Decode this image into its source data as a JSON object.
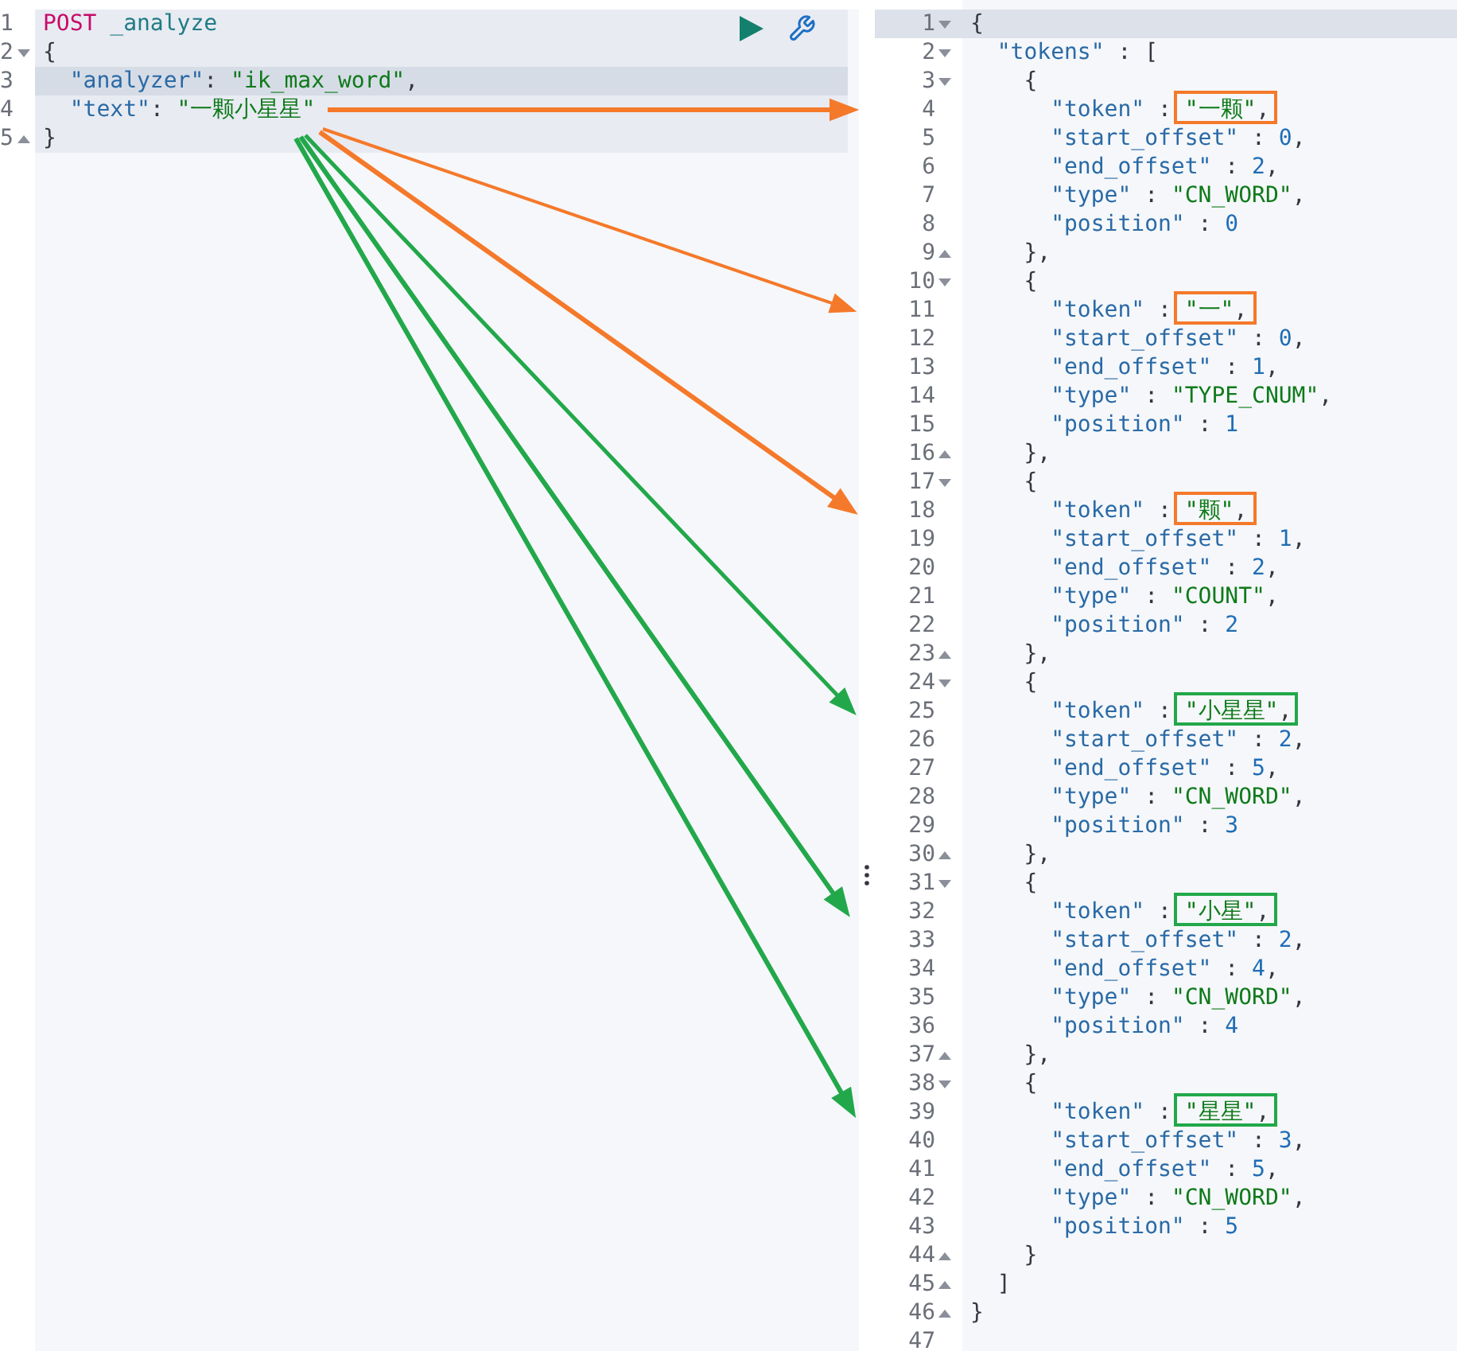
{
  "request": {
    "lines": [
      {
        "n": "1",
        "kind": "plain",
        "active": false,
        "segments": [
          {
            "kind": "method",
            "text": "POST"
          },
          {
            "kind": "path",
            "text": " _analyze"
          }
        ]
      },
      {
        "n": "2",
        "kind": "start",
        "active": false,
        "segments": [
          {
            "kind": "punct",
            "text": "{"
          }
        ]
      },
      {
        "n": "3",
        "kind": "plain",
        "active": true,
        "segments": [
          {
            "kind": "key",
            "text": "  \"analyzer\""
          },
          {
            "kind": "punct",
            "text": ": "
          },
          {
            "kind": "string",
            "text": "\"ik_max_word\""
          },
          {
            "kind": "punct",
            "text": ","
          }
        ]
      },
      {
        "n": "4",
        "kind": "plain",
        "active": false,
        "segments": [
          {
            "kind": "key",
            "text": "  \"text\""
          },
          {
            "kind": "punct",
            "text": ": "
          },
          {
            "kind": "string",
            "text": "\"一颗小星星\""
          }
        ]
      },
      {
        "n": "5",
        "kind": "end",
        "active": false,
        "segments": [
          {
            "kind": "punct",
            "text": "}"
          }
        ]
      }
    ]
  },
  "response": {
    "lines": [
      {
        "n": "1",
        "kind": "start",
        "active": true,
        "segments": [
          {
            "kind": "punct",
            "text": "{"
          }
        ]
      },
      {
        "n": "2",
        "kind": "start",
        "active": false,
        "segments": [
          {
            "kind": "key",
            "text": "  \"tokens\""
          },
          {
            "kind": "punct",
            "text": " : ["
          }
        ]
      },
      {
        "n": "3",
        "kind": "start",
        "active": false,
        "segments": [
          {
            "kind": "punct",
            "text": "    {"
          }
        ]
      },
      {
        "n": "4",
        "kind": "plain",
        "active": false,
        "segments": [
          {
            "kind": "key",
            "text": "      \"token\""
          },
          {
            "kind": "punct",
            "text": " : "
          },
          {
            "kind": "string",
            "text": "\"一颗\""
          },
          {
            "kind": "punct",
            "text": ","
          }
        ]
      },
      {
        "n": "5",
        "kind": "plain",
        "active": false,
        "segments": [
          {
            "kind": "key",
            "text": "      \"start_offset\""
          },
          {
            "kind": "punct",
            "text": " : "
          },
          {
            "kind": "number",
            "text": "0"
          },
          {
            "kind": "punct",
            "text": ","
          }
        ]
      },
      {
        "n": "6",
        "kind": "plain",
        "active": false,
        "segments": [
          {
            "kind": "key",
            "text": "      \"end_offset\""
          },
          {
            "kind": "punct",
            "text": " : "
          },
          {
            "kind": "number",
            "text": "2"
          },
          {
            "kind": "punct",
            "text": ","
          }
        ]
      },
      {
        "n": "7",
        "kind": "plain",
        "active": false,
        "segments": [
          {
            "kind": "key",
            "text": "      \"type\""
          },
          {
            "kind": "punct",
            "text": " : "
          },
          {
            "kind": "string",
            "text": "\"CN_WORD\""
          },
          {
            "kind": "punct",
            "text": ","
          }
        ]
      },
      {
        "n": "8",
        "kind": "plain",
        "active": false,
        "segments": [
          {
            "kind": "key",
            "text": "      \"position\""
          },
          {
            "kind": "punct",
            "text": " : "
          },
          {
            "kind": "number",
            "text": "0"
          }
        ]
      },
      {
        "n": "9",
        "kind": "end",
        "active": false,
        "segments": [
          {
            "kind": "punct",
            "text": "    },"
          }
        ]
      },
      {
        "n": "10",
        "kind": "start",
        "active": false,
        "segments": [
          {
            "kind": "punct",
            "text": "    {"
          }
        ]
      },
      {
        "n": "11",
        "kind": "plain",
        "active": false,
        "segments": [
          {
            "kind": "key",
            "text": "      \"token\""
          },
          {
            "kind": "punct",
            "text": " : "
          },
          {
            "kind": "string",
            "text": "\"一\""
          },
          {
            "kind": "punct",
            "text": ","
          }
        ]
      },
      {
        "n": "12",
        "kind": "plain",
        "active": false,
        "segments": [
          {
            "kind": "key",
            "text": "      \"start_offset\""
          },
          {
            "kind": "punct",
            "text": " : "
          },
          {
            "kind": "number",
            "text": "0"
          },
          {
            "kind": "punct",
            "text": ","
          }
        ]
      },
      {
        "n": "13",
        "kind": "plain",
        "active": false,
        "segments": [
          {
            "kind": "key",
            "text": "      \"end_offset\""
          },
          {
            "kind": "punct",
            "text": " : "
          },
          {
            "kind": "number",
            "text": "1"
          },
          {
            "kind": "punct",
            "text": ","
          }
        ]
      },
      {
        "n": "14",
        "kind": "plain",
        "active": false,
        "segments": [
          {
            "kind": "key",
            "text": "      \"type\""
          },
          {
            "kind": "punct",
            "text": " : "
          },
          {
            "kind": "string",
            "text": "\"TYPE_CNUM\""
          },
          {
            "kind": "punct",
            "text": ","
          }
        ]
      },
      {
        "n": "15",
        "kind": "plain",
        "active": false,
        "segments": [
          {
            "kind": "key",
            "text": "      \"position\""
          },
          {
            "kind": "punct",
            "text": " : "
          },
          {
            "kind": "number",
            "text": "1"
          }
        ]
      },
      {
        "n": "16",
        "kind": "end",
        "active": false,
        "segments": [
          {
            "kind": "punct",
            "text": "    },"
          }
        ]
      },
      {
        "n": "17",
        "kind": "start",
        "active": false,
        "segments": [
          {
            "kind": "punct",
            "text": "    {"
          }
        ]
      },
      {
        "n": "18",
        "kind": "plain",
        "active": false,
        "segments": [
          {
            "kind": "key",
            "text": "      \"token\""
          },
          {
            "kind": "punct",
            "text": " : "
          },
          {
            "kind": "string",
            "text": "\"颗\""
          },
          {
            "kind": "punct",
            "text": ","
          }
        ]
      },
      {
        "n": "19",
        "kind": "plain",
        "active": false,
        "segments": [
          {
            "kind": "key",
            "text": "      \"start_offset\""
          },
          {
            "kind": "punct",
            "text": " : "
          },
          {
            "kind": "number",
            "text": "1"
          },
          {
            "kind": "punct",
            "text": ","
          }
        ]
      },
      {
        "n": "20",
        "kind": "plain",
        "active": false,
        "segments": [
          {
            "kind": "key",
            "text": "      \"end_offset\""
          },
          {
            "kind": "punct",
            "text": " : "
          },
          {
            "kind": "number",
            "text": "2"
          },
          {
            "kind": "punct",
            "text": ","
          }
        ]
      },
      {
        "n": "21",
        "kind": "plain",
        "active": false,
        "segments": [
          {
            "kind": "key",
            "text": "      \"type\""
          },
          {
            "kind": "punct",
            "text": " : "
          },
          {
            "kind": "string",
            "text": "\"COUNT\""
          },
          {
            "kind": "punct",
            "text": ","
          }
        ]
      },
      {
        "n": "22",
        "kind": "plain",
        "active": false,
        "segments": [
          {
            "kind": "key",
            "text": "      \"position\""
          },
          {
            "kind": "punct",
            "text": " : "
          },
          {
            "kind": "number",
            "text": "2"
          }
        ]
      },
      {
        "n": "23",
        "kind": "end",
        "active": false,
        "segments": [
          {
            "kind": "punct",
            "text": "    },"
          }
        ]
      },
      {
        "n": "24",
        "kind": "start",
        "active": false,
        "segments": [
          {
            "kind": "punct",
            "text": "    {"
          }
        ]
      },
      {
        "n": "25",
        "kind": "plain",
        "active": false,
        "segments": [
          {
            "kind": "key",
            "text": "      \"token\""
          },
          {
            "kind": "punct",
            "text": " : "
          },
          {
            "kind": "string",
            "text": "\"小星星\""
          },
          {
            "kind": "punct",
            "text": ","
          }
        ]
      },
      {
        "n": "26",
        "kind": "plain",
        "active": false,
        "segments": [
          {
            "kind": "key",
            "text": "      \"start_offset\""
          },
          {
            "kind": "punct",
            "text": " : "
          },
          {
            "kind": "number",
            "text": "2"
          },
          {
            "kind": "punct",
            "text": ","
          }
        ]
      },
      {
        "n": "27",
        "kind": "plain",
        "active": false,
        "segments": [
          {
            "kind": "key",
            "text": "      \"end_offset\""
          },
          {
            "kind": "punct",
            "text": " : "
          },
          {
            "kind": "number",
            "text": "5"
          },
          {
            "kind": "punct",
            "text": ","
          }
        ]
      },
      {
        "n": "28",
        "kind": "plain",
        "active": false,
        "segments": [
          {
            "kind": "key",
            "text": "      \"type\""
          },
          {
            "kind": "punct",
            "text": " : "
          },
          {
            "kind": "string",
            "text": "\"CN_WORD\""
          },
          {
            "kind": "punct",
            "text": ","
          }
        ]
      },
      {
        "n": "29",
        "kind": "plain",
        "active": false,
        "segments": [
          {
            "kind": "key",
            "text": "      \"position\""
          },
          {
            "kind": "punct",
            "text": " : "
          },
          {
            "kind": "number",
            "text": "3"
          }
        ]
      },
      {
        "n": "30",
        "kind": "end",
        "active": false,
        "segments": [
          {
            "kind": "punct",
            "text": "    },"
          }
        ]
      },
      {
        "n": "31",
        "kind": "start",
        "active": false,
        "segments": [
          {
            "kind": "punct",
            "text": "    {"
          }
        ]
      },
      {
        "n": "32",
        "kind": "plain",
        "active": false,
        "segments": [
          {
            "kind": "key",
            "text": "      \"token\""
          },
          {
            "kind": "punct",
            "text": " : "
          },
          {
            "kind": "string",
            "text": "\"小星\""
          },
          {
            "kind": "punct",
            "text": ","
          }
        ]
      },
      {
        "n": "33",
        "kind": "plain",
        "active": false,
        "segments": [
          {
            "kind": "key",
            "text": "      \"start_offset\""
          },
          {
            "kind": "punct",
            "text": " : "
          },
          {
            "kind": "number",
            "text": "2"
          },
          {
            "kind": "punct",
            "text": ","
          }
        ]
      },
      {
        "n": "34",
        "kind": "plain",
        "active": false,
        "segments": [
          {
            "kind": "key",
            "text": "      \"end_offset\""
          },
          {
            "kind": "punct",
            "text": " : "
          },
          {
            "kind": "number",
            "text": "4"
          },
          {
            "kind": "punct",
            "text": ","
          }
        ]
      },
      {
        "n": "35",
        "kind": "plain",
        "active": false,
        "segments": [
          {
            "kind": "key",
            "text": "      \"type\""
          },
          {
            "kind": "punct",
            "text": " : "
          },
          {
            "kind": "string",
            "text": "\"CN_WORD\""
          },
          {
            "kind": "punct",
            "text": ","
          }
        ]
      },
      {
        "n": "36",
        "kind": "plain",
        "active": false,
        "segments": [
          {
            "kind": "key",
            "text": "      \"position\""
          },
          {
            "kind": "punct",
            "text": " : "
          },
          {
            "kind": "number",
            "text": "4"
          }
        ]
      },
      {
        "n": "37",
        "kind": "end",
        "active": false,
        "segments": [
          {
            "kind": "punct",
            "text": "    },"
          }
        ]
      },
      {
        "n": "38",
        "kind": "start",
        "active": false,
        "segments": [
          {
            "kind": "punct",
            "text": "    {"
          }
        ]
      },
      {
        "n": "39",
        "kind": "plain",
        "active": false,
        "segments": [
          {
            "kind": "key",
            "text": "      \"token\""
          },
          {
            "kind": "punct",
            "text": " : "
          },
          {
            "kind": "string",
            "text": "\"星星\""
          },
          {
            "kind": "punct",
            "text": ","
          }
        ]
      },
      {
        "n": "40",
        "kind": "plain",
        "active": false,
        "segments": [
          {
            "kind": "key",
            "text": "      \"start_offset\""
          },
          {
            "kind": "punct",
            "text": " : "
          },
          {
            "kind": "number",
            "text": "3"
          },
          {
            "kind": "punct",
            "text": ","
          }
        ]
      },
      {
        "n": "41",
        "kind": "plain",
        "active": false,
        "segments": [
          {
            "kind": "key",
            "text": "      \"end_offset\""
          },
          {
            "kind": "punct",
            "text": " : "
          },
          {
            "kind": "number",
            "text": "5"
          },
          {
            "kind": "punct",
            "text": ","
          }
        ]
      },
      {
        "n": "42",
        "kind": "plain",
        "active": false,
        "segments": [
          {
            "kind": "key",
            "text": "      \"type\""
          },
          {
            "kind": "punct",
            "text": " : "
          },
          {
            "kind": "string",
            "text": "\"CN_WORD\""
          },
          {
            "kind": "punct",
            "text": ","
          }
        ]
      },
      {
        "n": "43",
        "kind": "plain",
        "active": false,
        "segments": [
          {
            "kind": "key",
            "text": "      \"position\""
          },
          {
            "kind": "punct",
            "text": " : "
          },
          {
            "kind": "number",
            "text": "5"
          }
        ]
      },
      {
        "n": "44",
        "kind": "end",
        "active": false,
        "segments": [
          {
            "kind": "punct",
            "text": "    }"
          }
        ]
      },
      {
        "n": "45",
        "kind": "end",
        "active": false,
        "segments": [
          {
            "kind": "punct",
            "text": "  ]"
          }
        ]
      },
      {
        "n": "46",
        "kind": "end",
        "active": false,
        "segments": [
          {
            "kind": "punct",
            "text": "}"
          }
        ]
      },
      {
        "n": "47",
        "kind": "plain",
        "active": false
      }
    ]
  },
  "annotations": [
    {
      "color": "#f5792a"
    },
    {
      "color": "#f5792a"
    },
    {
      "color": "#f5792a"
    },
    {
      "color": "#22a84a"
    },
    {
      "color": "#22a84a"
    },
    {
      "color": "#22a84a"
    }
  ]
}
